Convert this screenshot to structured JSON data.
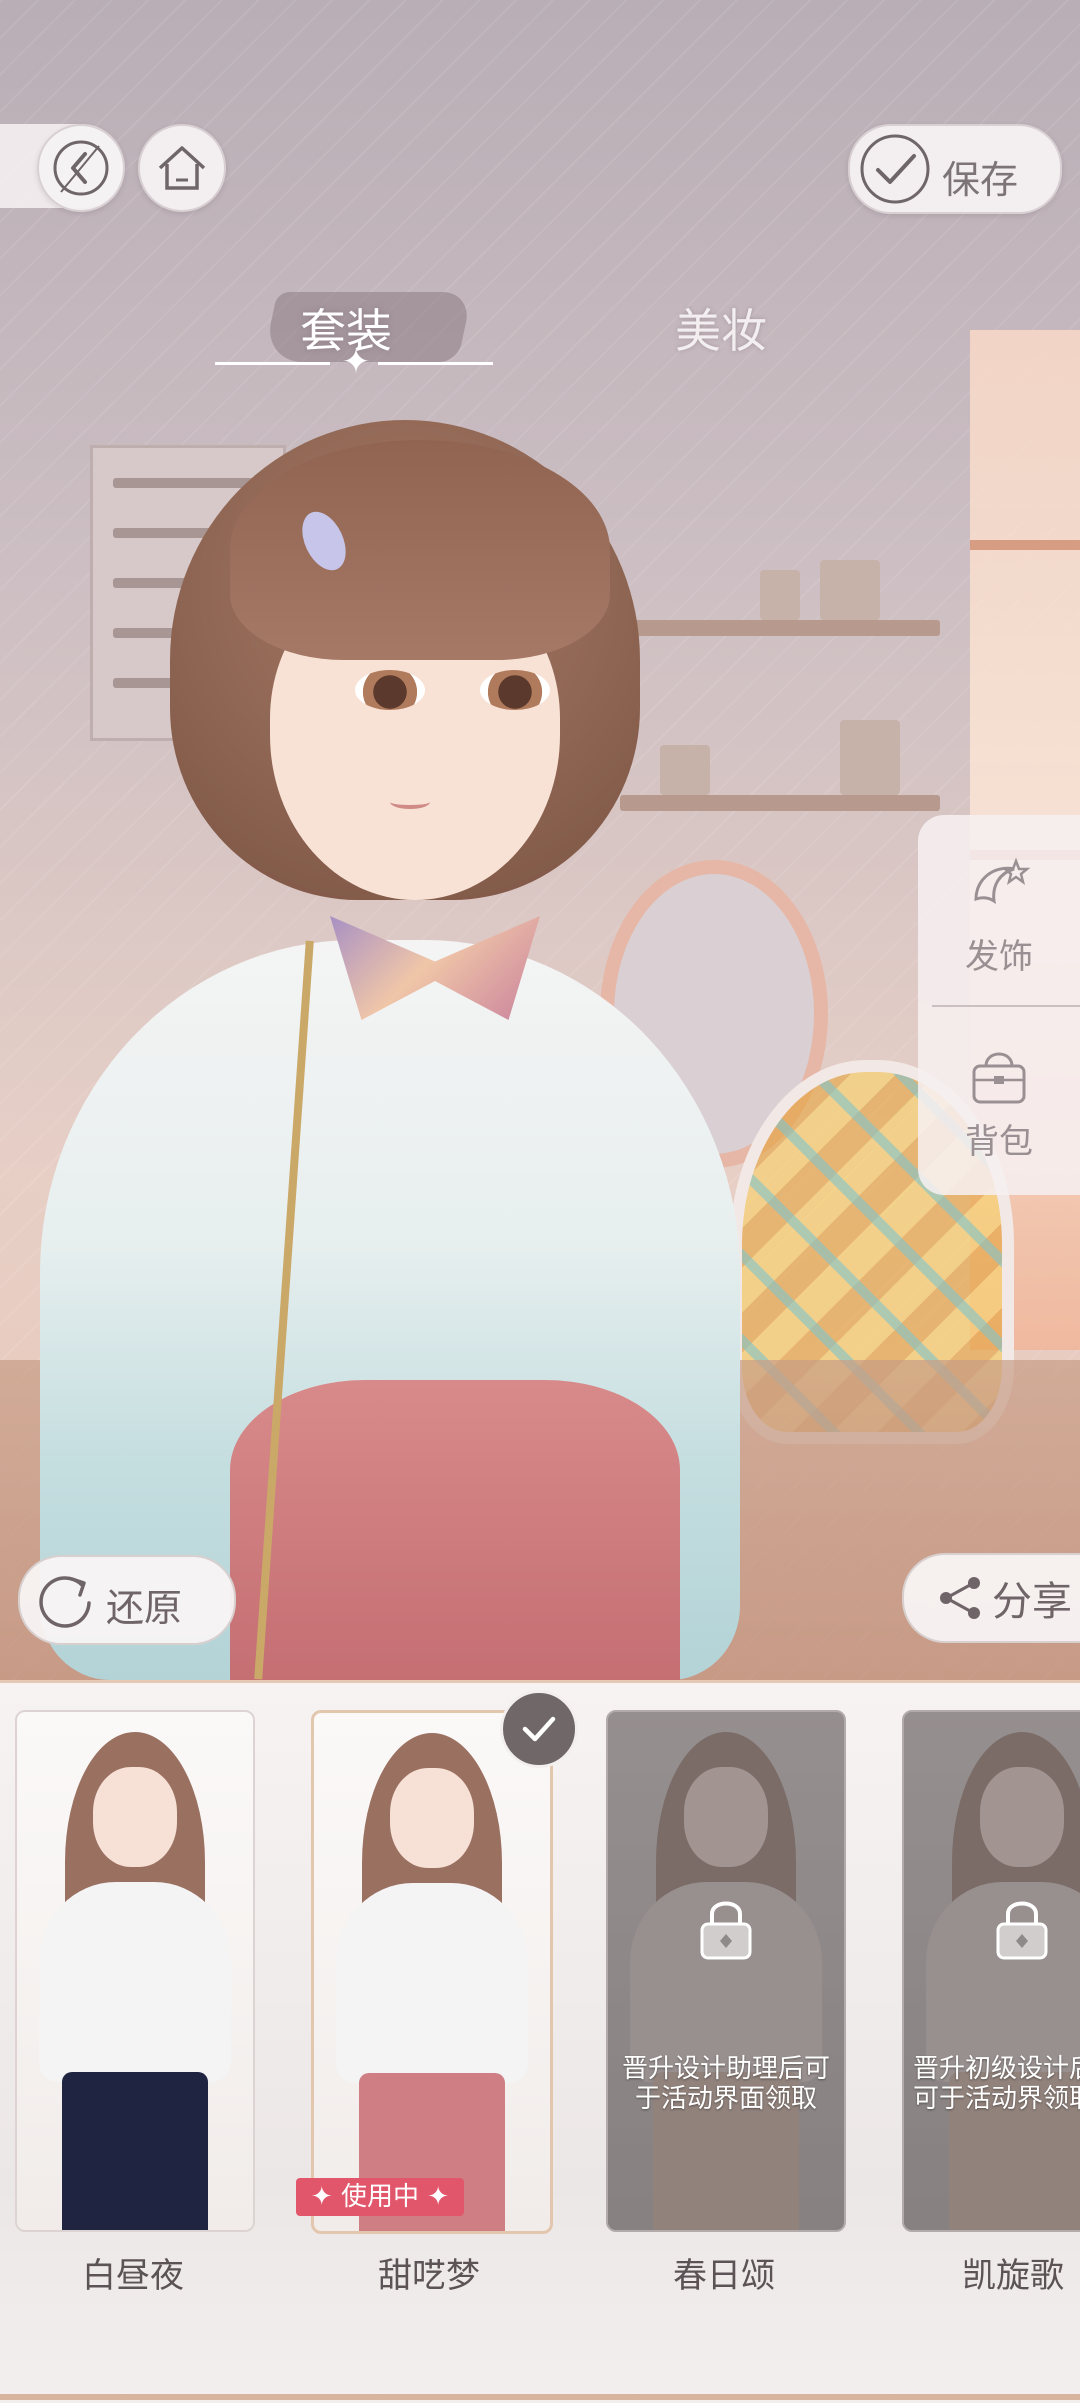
{
  "header": {
    "save_label": "保存"
  },
  "tabs": [
    {
      "label": "套装",
      "active": true
    },
    {
      "label": "美妆",
      "active": false
    }
  ],
  "side_panel": {
    "items": [
      {
        "label": "发饰",
        "icon": "hair-accessory-icon"
      },
      {
        "label": "背包",
        "icon": "bag-icon"
      }
    ]
  },
  "actions": {
    "restore_label": "还原",
    "share_label": "分享"
  },
  "outfits": [
    {
      "name": "白昼夜",
      "locked": false,
      "in_use": false,
      "selected": false
    },
    {
      "name": "甜呓梦",
      "locked": false,
      "in_use": true,
      "selected": true,
      "badge": "使用中"
    },
    {
      "name": "春日颂",
      "locked": true,
      "unlock_note": "晋升设计助理后可于活动界面领取"
    },
    {
      "name": "凯旋歌",
      "locked": true,
      "unlock_note": "晋升初级设计后可于活动界领取"
    }
  ],
  "colors": {
    "accent_badge": "#e2566b",
    "text_muted": "#7d7478"
  }
}
